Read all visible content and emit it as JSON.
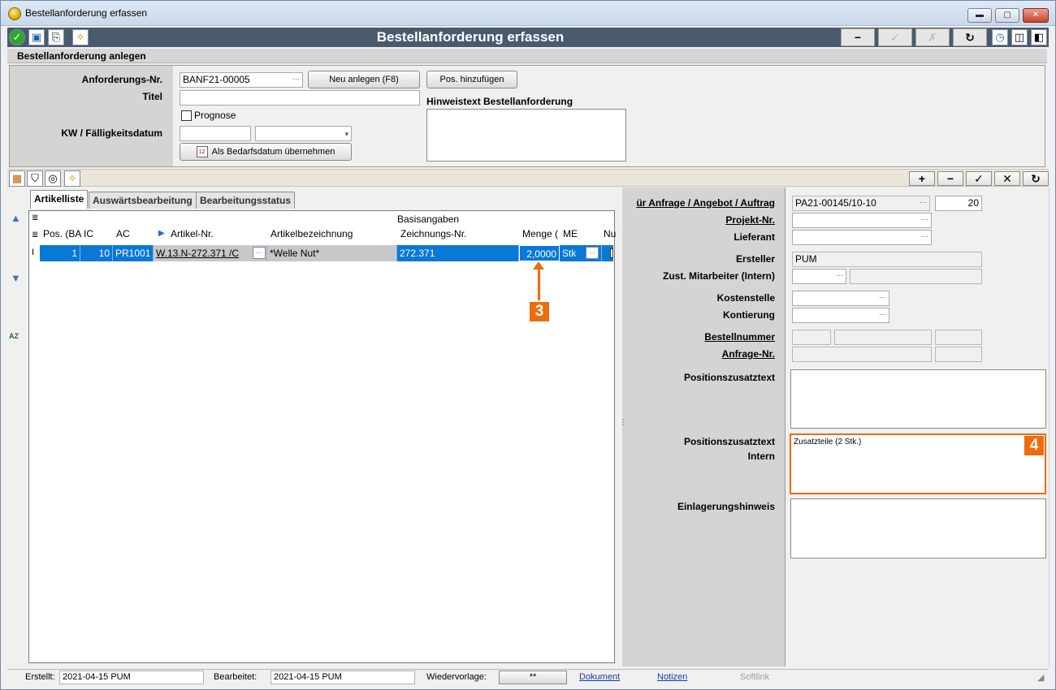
{
  "window": {
    "title": "Bestellanforderung erfassen",
    "min": "▬",
    "max": "▢",
    "close": "✕"
  },
  "toolbar": {
    "caption": "Bestellanforderung erfassen",
    "minus": "−",
    "check": "✓",
    "cross": "✗",
    "refresh": "↻"
  },
  "section": {
    "title": "Bestellanforderung anlegen"
  },
  "header": {
    "anforderungs_label": "Anforderungs-Nr.",
    "anforderungs_value": "BANF21-00005",
    "titel_label": "Titel",
    "titel_value": "",
    "prognose_label": "Prognose",
    "kw_label": "KW / Fälligkeitsdatum",
    "neu_button": "Neu anlegen (F8)",
    "pos_button": "Pos. hinzufügen",
    "bedarf_button": "Als Bedarfsdatum übernehmen",
    "hinweis_label": "Hinweistext Bestellanforderung",
    "hinweis_value": "",
    "calendar_icon_text": "12"
  },
  "strip": {
    "plus": "+",
    "minus": "−",
    "check": "✓",
    "cross": "✕",
    "refresh": "↻"
  },
  "tabs": [
    {
      "label": "Artikelliste"
    },
    {
      "label": "Auswärtsbearbeitung"
    },
    {
      "label": "Bearbeitungsstatus"
    }
  ],
  "grid": {
    "group_header": "Basisangaben",
    "columns": [
      "Pos. (BA",
      "IC",
      "AC",
      "Artikel-Nr.",
      "Artikelbezeichnung",
      "Zeichnungs-Nr.",
      "Menge (",
      "ME",
      "Nu"
    ],
    "row": {
      "pos": "1",
      "ic": "10",
      "ac": "PR1001",
      "artikel": "W.13.N-272.371 /C",
      "bezeichnung": "*Welle Nut*",
      "zeichnung": "272.371",
      "menge": "2,0000",
      "me": "Stk"
    },
    "sort_label": "AZ"
  },
  "detail": {
    "anfrage_label": "ür Anfrage / Angebot / Auftrag",
    "anfrage_value": "PA21-00145/10-10",
    "anfrage_qty": "20",
    "projekt_label": "Projekt-Nr.",
    "lieferant_label": "Lieferant",
    "ersteller_label": "Ersteller",
    "ersteller_value": "PUM",
    "mitarbeiter_label": "Zust. Mitarbeiter (Intern)",
    "kostenstelle_label": "Kostenstelle",
    "kontierung_label": "Kontierung",
    "bestellnummer_label": "Bestellnummer",
    "anfragenr_label": "Anfrage-Nr.",
    "poszusatz_label": "Positionszusatztext",
    "poszusatz_intern_label1": "Positionszusatztext",
    "poszusatz_intern_label2": "Intern",
    "poszusatz_intern_value": "Zusatzteile (2 Stk.)",
    "einlagerung_label": "Einlagerungshinweis"
  },
  "callouts": {
    "three": "3",
    "four": "4"
  },
  "status": {
    "erstellt_label": "Erstellt:",
    "erstellt_value": "2021-04-15  PUM",
    "bearbeitet_label": "Bearbeitet:",
    "bearbeitet_value": "2021-04-15  PUM",
    "wiedervorlage_label": "Wiedervorlage:",
    "wiedervorlage_value": "**",
    "dokument": "Dokument",
    "notizen": "Notizen",
    "softlink": "Softlink"
  },
  "colors": {
    "accent": "#ef6c0e",
    "selection": "#0a78d7",
    "toolbar": "#4a5a6e"
  }
}
